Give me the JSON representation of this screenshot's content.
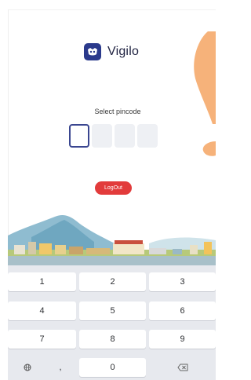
{
  "app": {
    "name": "Vigilo"
  },
  "pin": {
    "label": "Select pincode",
    "length": 4,
    "active_index": 0
  },
  "logout": {
    "label": "LogOut"
  },
  "keypad": {
    "rows": [
      [
        "1",
        "2",
        "3"
      ],
      [
        "4",
        "5",
        "6"
      ],
      [
        "7",
        "8",
        "9"
      ]
    ],
    "bottom": {
      "left_icon": "globe-icon",
      "punct": ",",
      "zero": "0",
      "backspace_icon": "backspace-icon"
    }
  },
  "colors": {
    "brand": "#2b3a8c",
    "logout": "#e23b3b",
    "accent_orange": "#f4a261"
  }
}
